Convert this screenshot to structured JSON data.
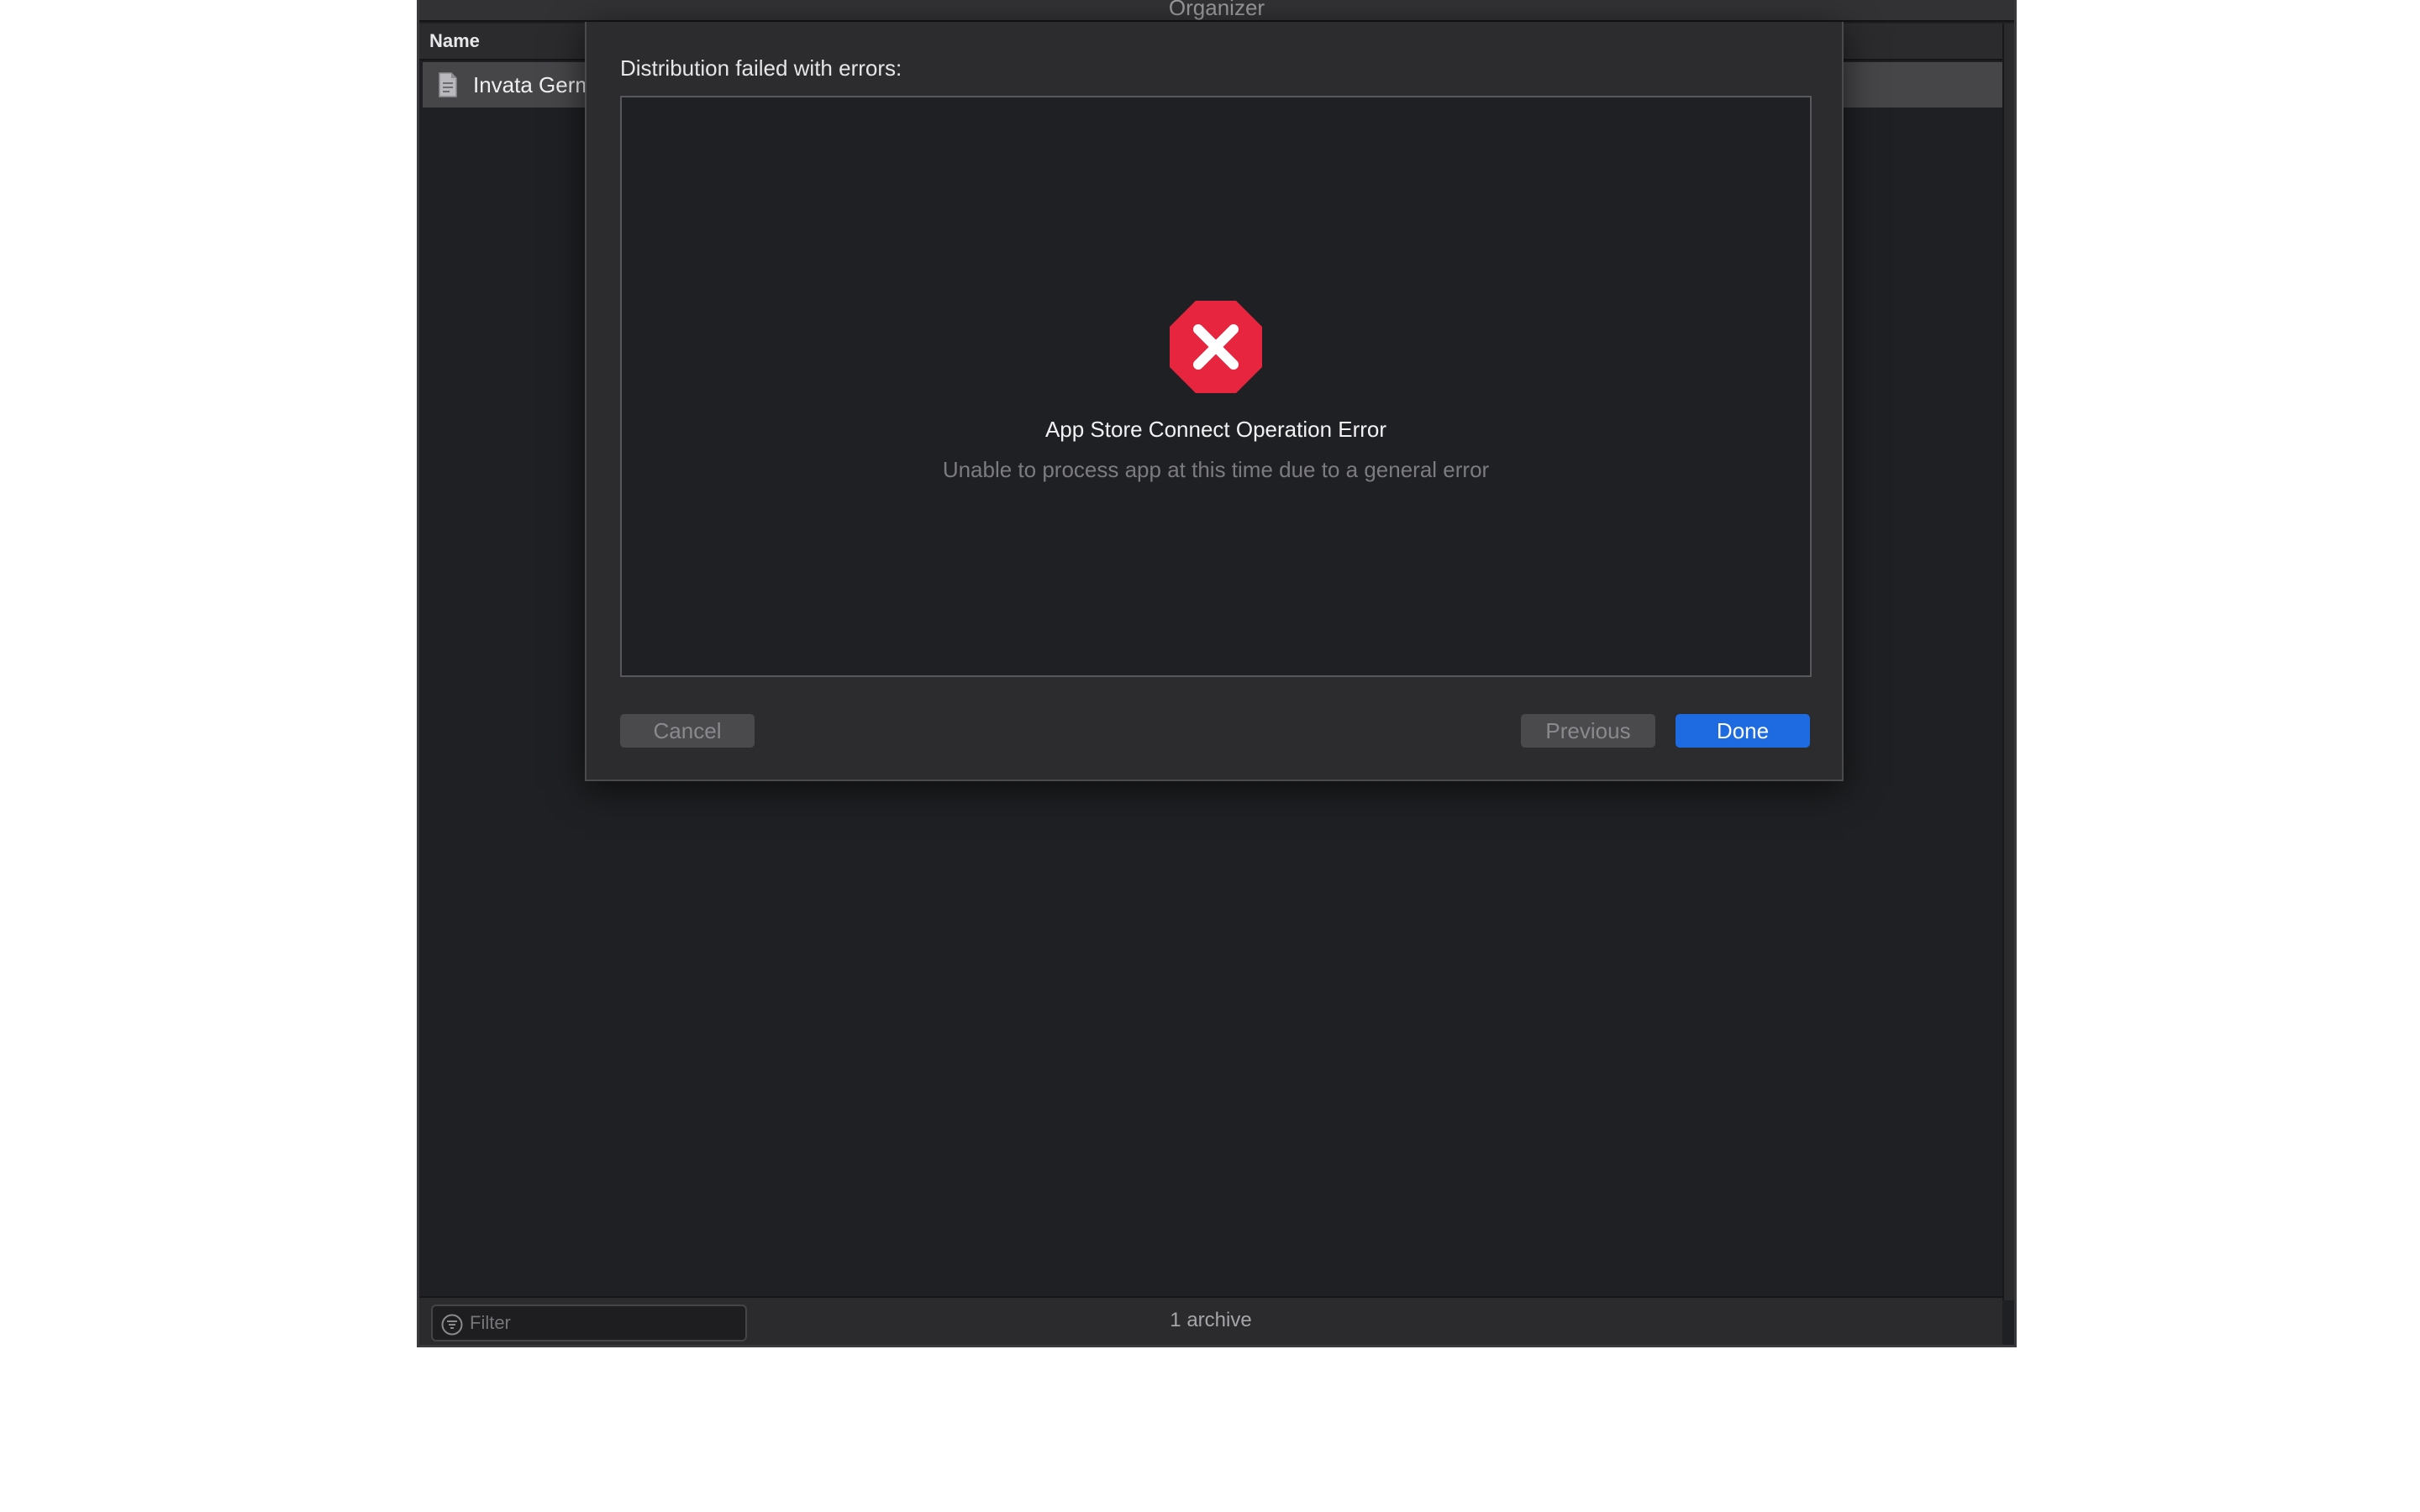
{
  "window": {
    "title": "Organizer"
  },
  "list": {
    "column_name": "Name",
    "rows": [
      {
        "name": "Invata Germ"
      }
    ]
  },
  "bottom_bar": {
    "filter_placeholder": "Filter",
    "archive_count": "1 archive"
  },
  "sheet": {
    "heading": "Distribution failed with errors:",
    "error": {
      "icon": "error-x-octagon-icon",
      "title": "App Store Connect Operation Error",
      "message": "Unable to process app at this time due to a general error"
    },
    "buttons": {
      "cancel": "Cancel",
      "previous": "Previous",
      "done": "Done"
    }
  },
  "colors": {
    "error_red": "#e8253f",
    "accent_blue": "#1e6ae0"
  }
}
